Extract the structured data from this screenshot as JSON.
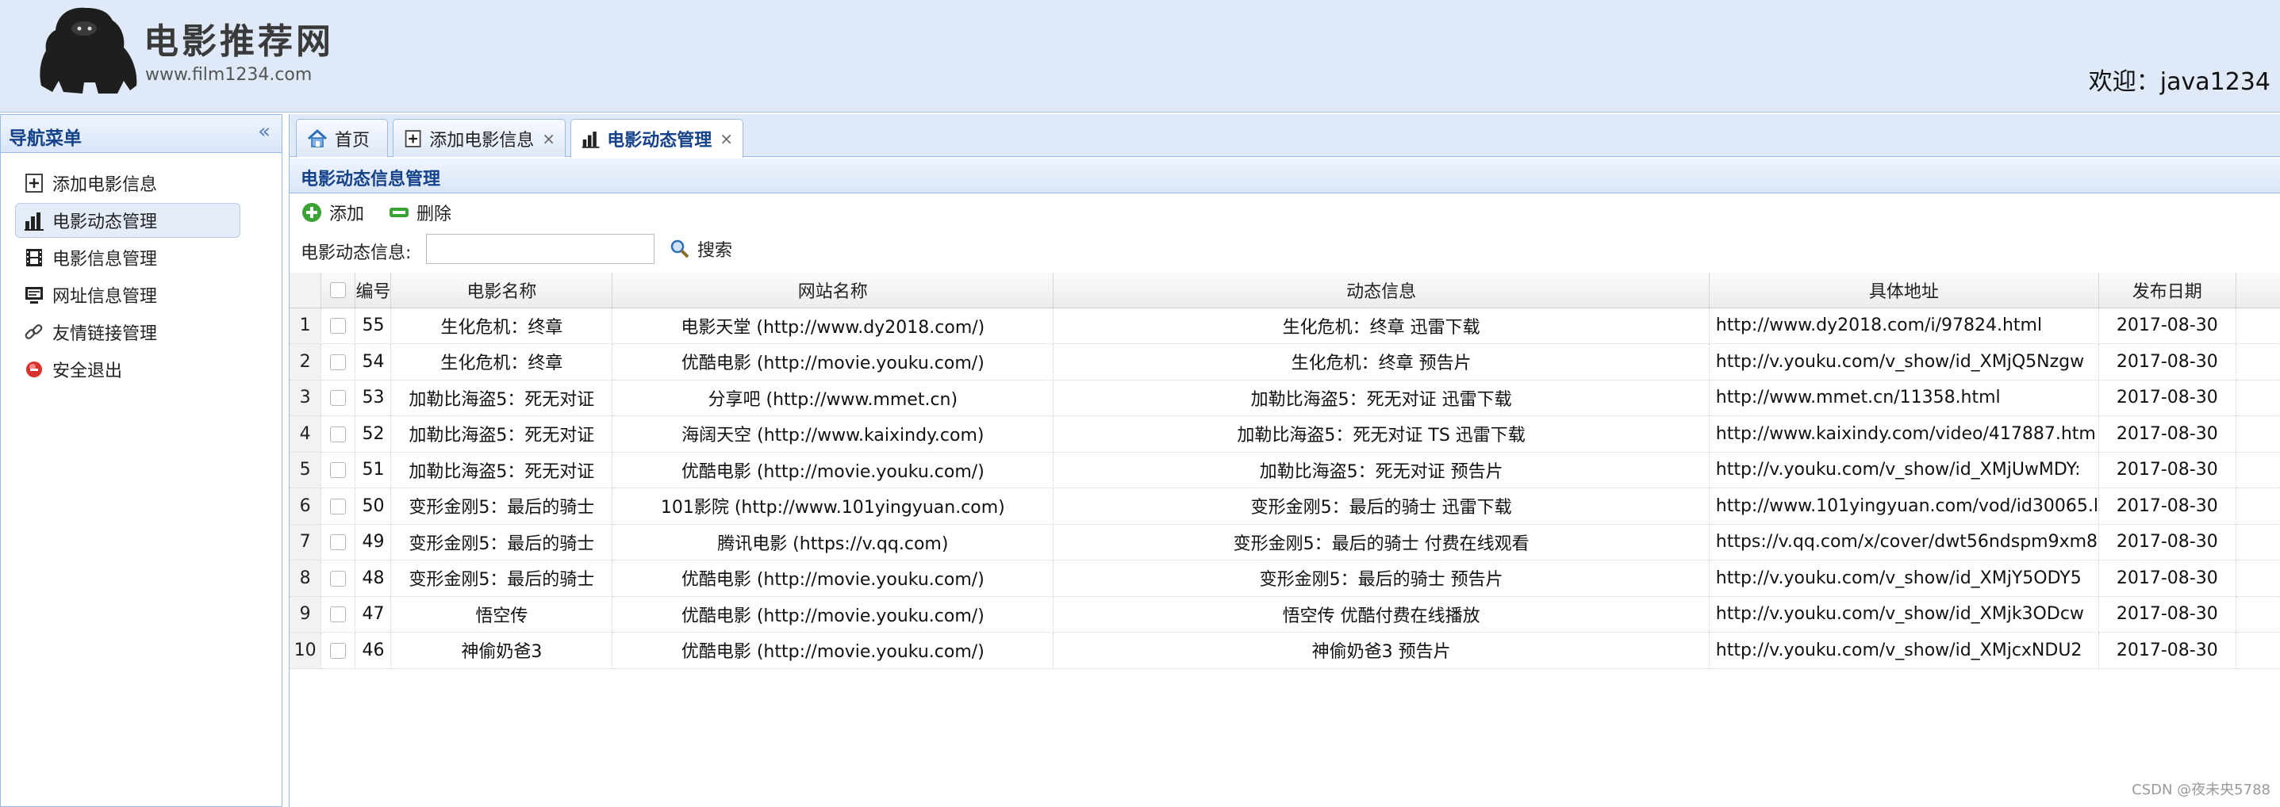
{
  "header": {
    "logo_title": "电影推荐网",
    "logo_url": "www.film1234.com",
    "welcome": "欢迎：java1234"
  },
  "nav": {
    "title": "导航菜单",
    "collapse_glyph": "«",
    "items": [
      {
        "label": "添加电影信息",
        "icon": "add-doc-icon"
      },
      {
        "label": "电影动态管理",
        "icon": "bar-chart-icon",
        "active": true
      },
      {
        "label": "电影信息管理",
        "icon": "film-icon"
      },
      {
        "label": "网址信息管理",
        "icon": "monitor-icon"
      },
      {
        "label": "友情链接管理",
        "icon": "link-icon"
      },
      {
        "label": "安全退出",
        "icon": "exit-icon"
      }
    ]
  },
  "tabs": [
    {
      "label": "首页",
      "icon": "home-icon",
      "closable": false
    },
    {
      "label": "添加电影信息",
      "icon": "add-doc-icon",
      "closable": true
    },
    {
      "label": "电影动态管理",
      "icon": "bar-chart-icon",
      "closable": true,
      "active": true
    }
  ],
  "tab_close_glyph": "×",
  "panel": {
    "title": "电影动态信息管理",
    "add_label": "添加",
    "delete_label": "删除",
    "search_label": "电影动态信息:",
    "search_value": "",
    "search_button": "搜索"
  },
  "grid": {
    "columns": [
      "编号",
      "电影名称",
      "网站名称",
      "动态信息",
      "具体地址",
      "发布日期"
    ],
    "rows": [
      {
        "n": "1",
        "id": "55",
        "film": "生化危机：终章",
        "site": "电影天堂 (http://www.dy2018.com/)",
        "info": "生化危机：终章 迅雷下载",
        "url": "http://www.dy2018.com/i/97824.html",
        "date": "2017-08-30"
      },
      {
        "n": "2",
        "id": "54",
        "film": "生化危机：终章",
        "site": "优酷电影 (http://movie.youku.com/)",
        "info": "生化危机：终章 预告片",
        "url": "http://v.youku.com/v_show/id_XMjQ5Nzgw",
        "date": "2017-08-30"
      },
      {
        "n": "3",
        "id": "53",
        "film": "加勒比海盗5：死无对证",
        "site": "分享吧 (http://www.mmet.cn)",
        "info": "加勒比海盗5：死无对证 迅雷下载",
        "url": "http://www.mmet.cn/11358.html",
        "date": "2017-08-30"
      },
      {
        "n": "4",
        "id": "52",
        "film": "加勒比海盗5：死无对证",
        "site": "海阔天空 (http://www.kaixindy.com)",
        "info": "加勒比海盗5：死无对证 TS 迅雷下载",
        "url": "http://www.kaixindy.com/video/417887.htm",
        "date": "2017-08-30"
      },
      {
        "n": "5",
        "id": "51",
        "film": "加勒比海盗5：死无对证",
        "site": "优酷电影 (http://movie.youku.com/)",
        "info": "加勒比海盗5：死无对证 预告片",
        "url": "http://v.youku.com/v_show/id_XMjUwMDY:",
        "date": "2017-08-30"
      },
      {
        "n": "6",
        "id": "50",
        "film": "变形金刚5：最后的骑士",
        "site": "101影院 (http://www.101yingyuan.com)",
        "info": "变形金刚5：最后的骑士 迅雷下载",
        "url": "http://www.101yingyuan.com/vod/id30065.l",
        "date": "2017-08-30"
      },
      {
        "n": "7",
        "id": "49",
        "film": "变形金刚5：最后的骑士",
        "site": "腾讯电影 (https://v.qq.com)",
        "info": "变形金刚5：最后的骑士 付费在线观看",
        "url": "https://v.qq.com/x/cover/dwt56ndspm9xm8",
        "date": "2017-08-30"
      },
      {
        "n": "8",
        "id": "48",
        "film": "变形金刚5：最后的骑士",
        "site": "优酷电影 (http://movie.youku.com/)",
        "info": "变形金刚5：最后的骑士 预告片",
        "url": "http://v.youku.com/v_show/id_XMjY5ODY5",
        "date": "2017-08-30"
      },
      {
        "n": "9",
        "id": "47",
        "film": "悟空传",
        "site": "优酷电影 (http://movie.youku.com/)",
        "info": "悟空传 优酷付费在线播放",
        "url": "http://v.youku.com/v_show/id_XMjk3ODcw",
        "date": "2017-08-30"
      },
      {
        "n": "10",
        "id": "46",
        "film": "神偷奶爸3",
        "site": "优酷电影 (http://movie.youku.com/)",
        "info": "神偷奶爸3 预告片",
        "url": "http://v.youku.com/v_show/id_XMjcxNDU2",
        "date": "2017-08-30"
      }
    ]
  },
  "watermark": "CSDN @夜未央5788",
  "colors": {
    "header_bg": "#dfe9f8",
    "panel_title": "#15428b",
    "border": "#99bbe8"
  }
}
